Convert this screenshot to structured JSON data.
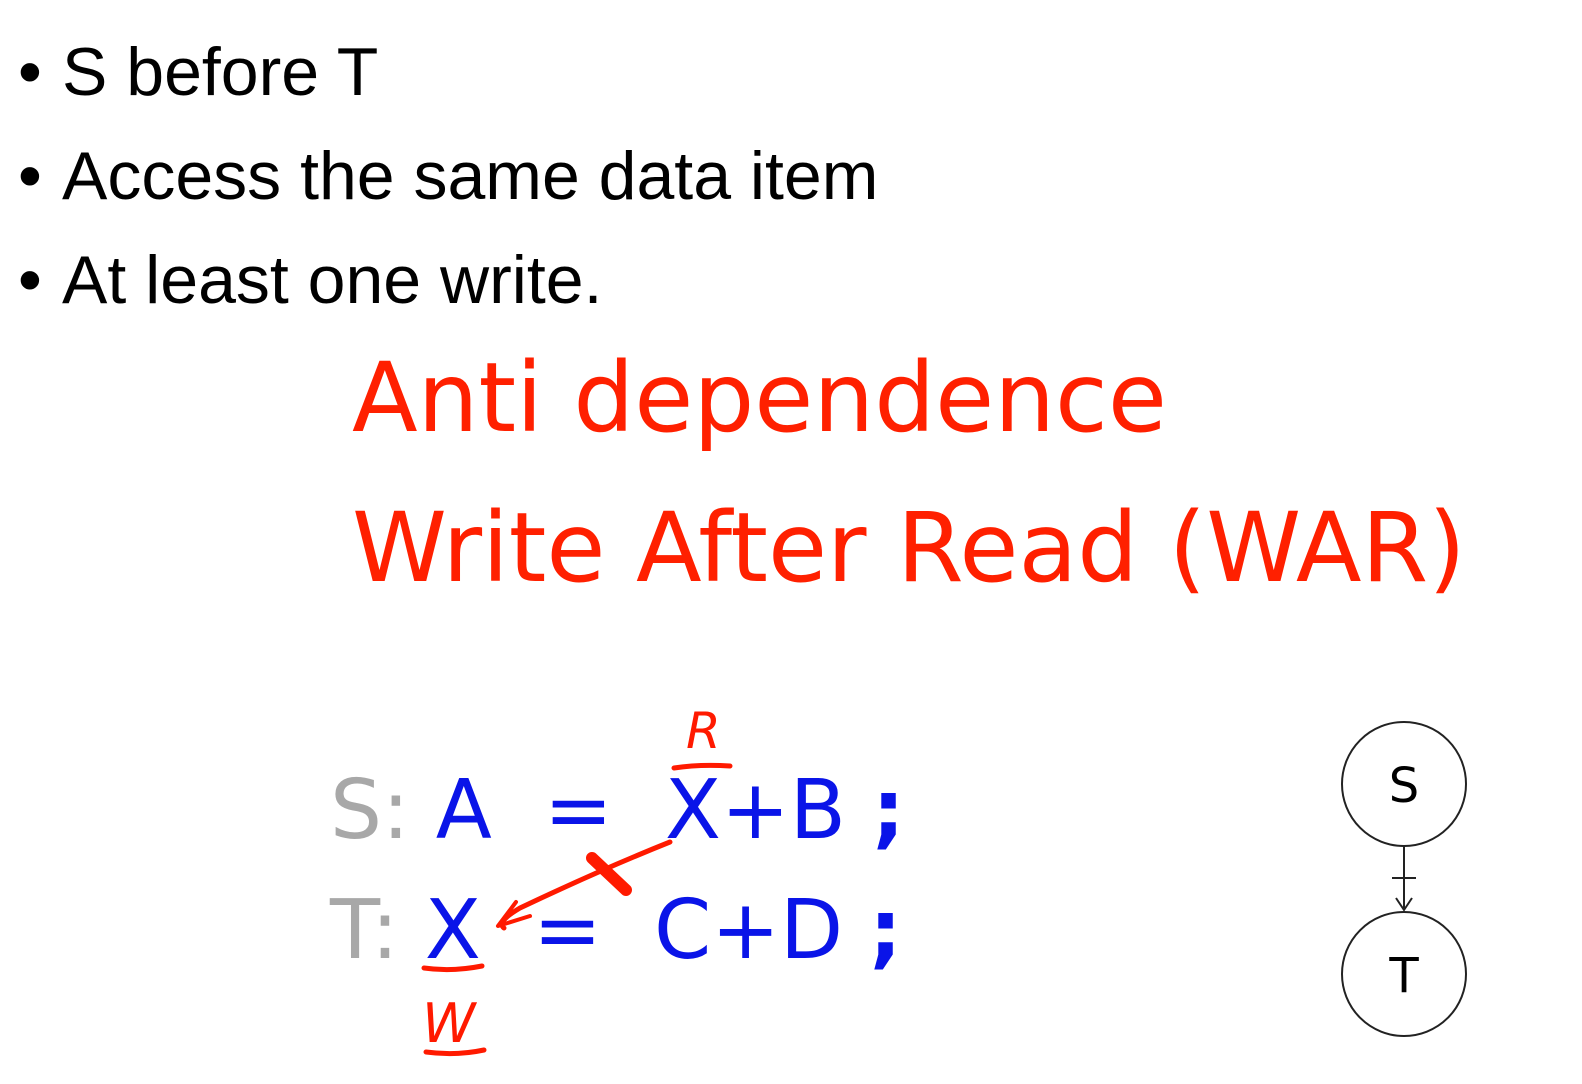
{
  "bullets": [
    {
      "marker": "•",
      "text": "S before T"
    },
    {
      "marker": "•",
      "text": "Access the same data item"
    },
    {
      "marker": "•",
      "text": "At least one write."
    }
  ],
  "headings": {
    "line1": "Anti dependence",
    "line2": "Write After Read (WAR)"
  },
  "statements": {
    "s": {
      "label": "S:",
      "lhs": "A",
      "op": "=",
      "rhs": "X+B",
      "end": ";"
    },
    "t": {
      "label": "T:",
      "lhs": "X",
      "op": "=",
      "rhs": "C+D",
      "end": ";"
    }
  },
  "annotations": {
    "read_mark": "R",
    "write_mark": "W"
  },
  "graph": {
    "nodes": [
      "S",
      "T"
    ]
  },
  "colors": {
    "heading": "#ff2000",
    "code": "#0a14e8",
    "label": "#a8a8a8",
    "ink": "#ff1a00"
  }
}
